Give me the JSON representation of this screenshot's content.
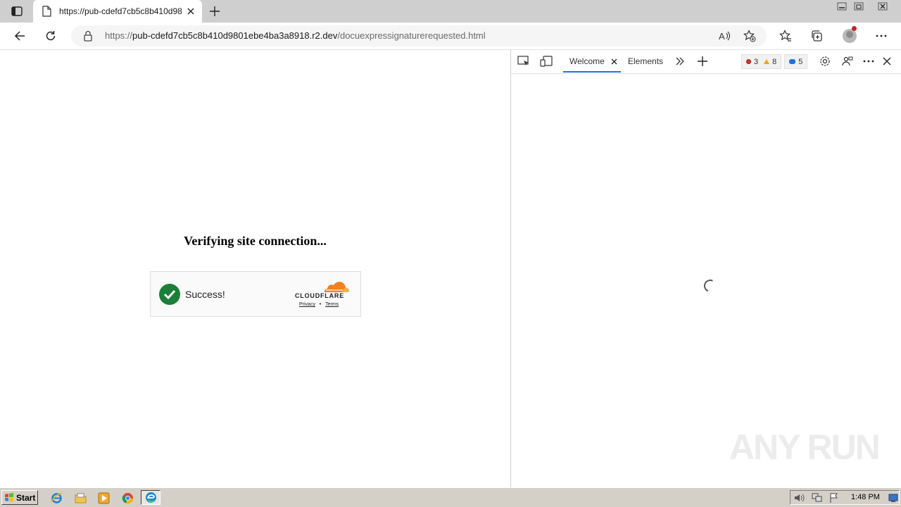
{
  "browser": {
    "tab_title": "https://pub-cdefd7cb5c8b410d98",
    "url_proto": "https://",
    "url_host": "pub-cdefd7cb5c8b410d9801ebe4ba3a8918.r2.dev",
    "url_path": "/docuexpressignaturerequested.html"
  },
  "page": {
    "heading": "Verifying site connection...",
    "turnstile": {
      "status": "Success!",
      "brand": "CLOUDFLARE",
      "privacy": "Privacy",
      "separator": "•",
      "terms": "Terms"
    }
  },
  "devtools": {
    "tabs": [
      "Welcome",
      "Elements"
    ],
    "errors": "3",
    "warnings": "8",
    "messages": "5"
  },
  "watermark": "ANY RUN",
  "taskbar": {
    "start_label": "Start",
    "clock": "1:48 PM"
  },
  "colors": {
    "success_green": "#1a7f37",
    "cloudflare_orange": "#f38020",
    "devtools_accent": "#1a73e8"
  }
}
